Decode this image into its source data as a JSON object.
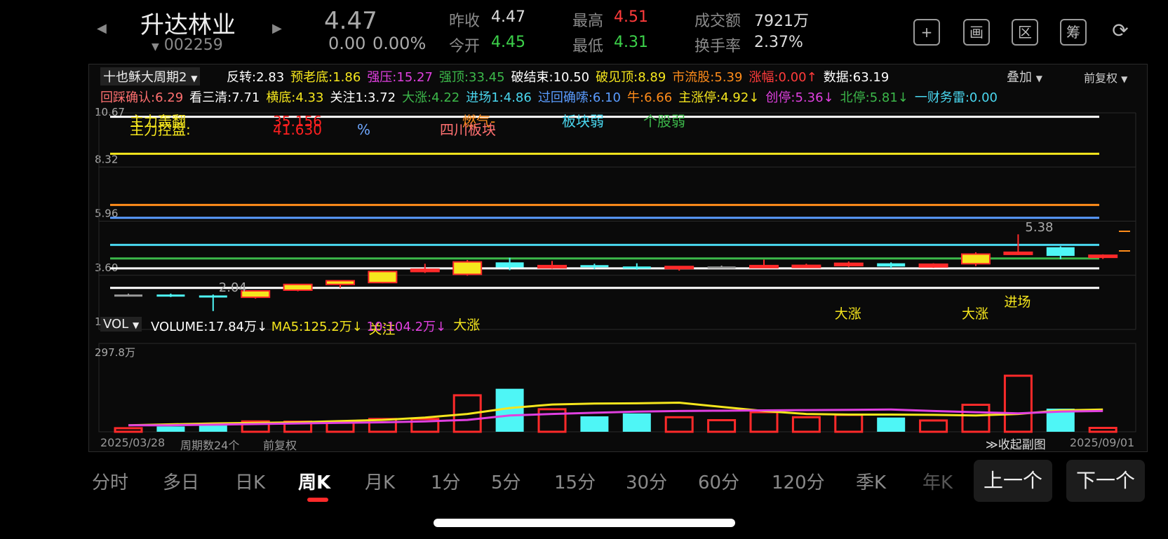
{
  "stock": {
    "name": "升达林业",
    "code": "002259",
    "price": "4.47",
    "change": "0.00",
    "change_pct": "0.00%",
    "prev_close_label": "昨收",
    "prev_close": "4.47",
    "open_label": "今开",
    "open": "4.45",
    "high_label": "最高",
    "high": "4.51",
    "low_label": "最低",
    "low": "4.31",
    "turnover_label": "成交额",
    "turnover": "7921万",
    "turnover_rate_label": "换手率",
    "turnover_rate": "2.37%"
  },
  "header_icons": [
    "plus-icon",
    "draw-icon",
    "range-icon",
    "chip-icon",
    "rotate-icon"
  ],
  "header_icon_glyphs": [
    "+",
    "画",
    "区",
    "筹",
    "⟳"
  ],
  "indicator": {
    "selector": "十也稣大周期2",
    "overlay_label": "叠加",
    "adjust_label": "前复权",
    "row1": [
      {
        "t": "反转:2.83",
        "c": "#ffffff"
      },
      {
        "t": "预老底:1.86",
        "c": "#f5e61d"
      },
      {
        "t": "强压:15.27",
        "c": "#e040e0"
      },
      {
        "t": "强顶:33.45",
        "c": "#3cb84a"
      },
      {
        "t": "破结束:10.50",
        "c": "#ffffff"
      },
      {
        "t": "破见顶:8.89",
        "c": "#f5e61d"
      },
      {
        "t": "市流股:5.39",
        "c": "#ff8c1a"
      },
      {
        "t": "涨幅:0.00↑",
        "c": "#ff3b3b"
      },
      {
        "t": "数据:63.19",
        "c": "#ffffff"
      }
    ],
    "row2": [
      {
        "t": "回踩确认:6.29",
        "c": "#ff7070"
      },
      {
        "t": "看三清:7.71",
        "c": "#ffffff"
      },
      {
        "t": "横底:4.33",
        "c": "#f5e61d"
      },
      {
        "t": "关注1:3.72",
        "c": "#ffffff"
      },
      {
        "t": "大涨:4.22",
        "c": "#3cb84a"
      },
      {
        "t": "进场1:4.86",
        "c": "#4ad8f0"
      },
      {
        "t": "过回确嗦:6.10",
        "c": "#5a9cff"
      },
      {
        "t": "牛:6.66",
        "c": "#ff8c1a"
      },
      {
        "t": "主涨停:4.92↓",
        "c": "#f5e61d"
      },
      {
        "t": "创停:5.36↓",
        "c": "#e040e0"
      },
      {
        "t": "北停:5.81↓",
        "c": "#3cb84a"
      },
      {
        "t": "一财务雷:0.00",
        "c": "#4ad8f0"
      }
    ],
    "chart_texts": [
      {
        "t": "主力轰翻",
        "c": "#f5e61d"
      },
      {
        "t": "主力控盘:",
        "c": "#f5e61d"
      },
      {
        "t": "35.156",
        "c": "#ff2020"
      },
      {
        "t": "41.630",
        "c": "#ff2020"
      },
      {
        "t": "%",
        "c": "#6fa8ff"
      },
      {
        "t": "燃气-",
        "c": "#ff8c1a"
      },
      {
        "t": "四川板块",
        "c": "#ff7070"
      },
      {
        "t": "板块弱",
        "c": "#4ad8f0"
      },
      {
        "t": "个股弱",
        "c": "#3cb84a"
      }
    ],
    "candle_labels": [
      "关注",
      "大涨",
      "大涨",
      "大涨",
      "进场"
    ],
    "low_label": "2.04",
    "high_label": "5.38"
  },
  "volume": {
    "selector": "VOL",
    "volume_text": "VOLUME:17.84万↓",
    "ma5_text": "MA5:125.2万↓",
    "ma10_text": "10:104.2万↓",
    "max_label": "297.8万"
  },
  "footer": {
    "start_date": "2025/03/28",
    "period_count": "周期数24个",
    "adjust": "前复权",
    "collapse": "≫收起副图",
    "end_date": "2025/09/01"
  },
  "tabs": [
    "分时",
    "多日",
    "日K",
    "周K",
    "月K",
    "1分",
    "5分",
    "15分",
    "30分",
    "60分",
    "120分",
    "季K",
    "年K"
  ],
  "active_tab": "周K",
  "nav": {
    "prev": "上一个",
    "next": "下一个"
  },
  "colors": {
    "up": "#ff2a2a",
    "down": "#4ef6f6",
    "flat": "#999999",
    "yellow": "#f5e61d",
    "magenta": "#e040e0"
  },
  "chart_data": {
    "type": "candlestick",
    "y_ticks": [
      "10.67",
      "8.32",
      "5.96",
      "3.60",
      "1.24"
    ],
    "ylim": [
      1.24,
      10.67
    ],
    "candles": [
      {
        "o": 2.76,
        "h": 2.8,
        "l": 2.7,
        "c": 2.76,
        "v": 12
      },
      {
        "o": 2.76,
        "h": 2.8,
        "l": 2.65,
        "c": 2.72,
        "v": 18
      },
      {
        "o": 2.72,
        "h": 2.76,
        "l": 2.04,
        "c": 2.66,
        "v": 21
      },
      {
        "o": 2.64,
        "h": 2.95,
        "l": 2.58,
        "c": 2.92,
        "v": 35
      },
      {
        "o": 2.95,
        "h": 3.22,
        "l": 2.9,
        "c": 3.2,
        "v": 34
      },
      {
        "o": 3.2,
        "h": 3.3,
        "l": 3.05,
        "c": 3.36,
        "v": 34
      },
      {
        "o": 3.28,
        "h": 3.78,
        "l": 3.25,
        "c": 3.76,
        "v": 43
      },
      {
        "o": 3.76,
        "h": 4.1,
        "l": 3.7,
        "c": 3.86,
        "v": 43
      },
      {
        "o": 3.64,
        "h": 4.26,
        "l": 3.58,
        "c": 4.18,
        "v": 123
      },
      {
        "o": 4.16,
        "h": 4.36,
        "l": 3.82,
        "c": 3.94,
        "v": 145
      },
      {
        "o": 3.92,
        "h": 4.22,
        "l": 3.88,
        "c": 4.02,
        "v": 76
      },
      {
        "o": 4.04,
        "h": 4.1,
        "l": 3.86,
        "c": 3.96,
        "v": 52
      },
      {
        "o": 3.98,
        "h": 4.12,
        "l": 3.84,
        "c": 3.9,
        "v": 62
      },
      {
        "o": 3.9,
        "h": 4.0,
        "l": 3.8,
        "c": 3.98,
        "v": 49
      },
      {
        "o": 3.98,
        "h": 4.02,
        "l": 3.96,
        "c": 3.98,
        "v": 39
      },
      {
        "o": 3.96,
        "h": 4.28,
        "l": 3.92,
        "c": 4.02,
        "v": 66
      },
      {
        "o": 4.0,
        "h": 4.1,
        "l": 3.96,
        "c": 4.03,
        "v": 49
      },
      {
        "o": 4.02,
        "h": 4.2,
        "l": 3.96,
        "c": 4.12,
        "v": 57
      },
      {
        "o": 4.12,
        "h": 4.16,
        "l": 3.9,
        "c": 3.98,
        "v": 48
      },
      {
        "o": 3.96,
        "h": 4.12,
        "l": 3.92,
        "c": 4.08,
        "v": 38
      },
      {
        "o": 4.1,
        "h": 4.6,
        "l": 4.0,
        "c": 4.52,
        "v": 91
      },
      {
        "o": 4.52,
        "h": 5.38,
        "l": 4.48,
        "c": 4.6,
        "v": 189
      },
      {
        "o": 4.82,
        "h": 4.86,
        "l": 4.3,
        "c": 4.44,
        "v": 78
      },
      {
        "o": 4.45,
        "h": 4.51,
        "l": 4.31,
        "c": 4.47,
        "v": 13
      }
    ],
    "levels": [
      {
        "y": 10.5,
        "c": "#ffffff"
      },
      {
        "y": 8.89,
        "c": "#f5e61d"
      },
      {
        "y": 6.66,
        "c": "#ff8c1a"
      },
      {
        "y": 6.1,
        "c": "#5a9cff"
      },
      {
        "y": 4.92,
        "c": "#4ad8f0"
      },
      {
        "y": 4.33,
        "c": "#3cb84a"
      },
      {
        "y": 3.9,
        "c": "#ffffff"
      },
      {
        "y": 3.05,
        "c": "#ffffff"
      }
    ],
    "volume_max": 297.8,
    "ma5": [
      22,
      25,
      28,
      30,
      32,
      36,
      40,
      48,
      60,
      80,
      92,
      95,
      96,
      98,
      84,
      70,
      60,
      58,
      58,
      57,
      55,
      60,
      72,
      75,
      70
    ],
    "ma10": [
      22,
      22,
      24,
      26,
      28,
      30,
      32,
      35,
      40,
      55,
      60,
      64,
      68,
      70,
      71,
      72,
      73,
      74,
      75,
      70,
      66,
      62,
      68,
      70,
      64
    ]
  }
}
